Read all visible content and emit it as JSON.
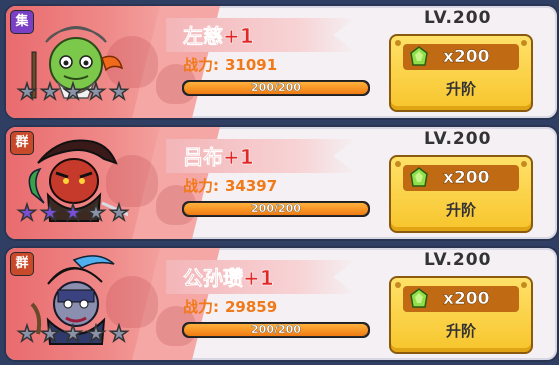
{
  "heroes": [
    {
      "faction": "集",
      "faction_color": "#7a3fc4",
      "name": "左慈+1",
      "power_label": "战力:",
      "power_value": "31091",
      "progress_text": "200/200",
      "progress": 1.0,
      "stars_filled": 0,
      "level": "LV.200",
      "cost": "x200",
      "upgrade_label": "升阶",
      "portrait": "zuo-ci-portrait"
    },
    {
      "faction": "群",
      "faction_color": "#c94a2a",
      "name": "吕布+1",
      "power_label": "战力:",
      "power_value": "34397",
      "progress_text": "200/200",
      "progress": 1.0,
      "stars_filled": 3,
      "level": "LV.200",
      "cost": "x200",
      "upgrade_label": "升阶",
      "portrait": "lu-bu-portrait"
    },
    {
      "faction": "群",
      "faction_color": "#c94a2a",
      "name": "公孙瓒+1",
      "power_label": "战力:",
      "power_value": "29859",
      "progress_text": "200/200",
      "progress": 1.0,
      "stars_filled": 0,
      "level": "LV.200",
      "cost": "x200",
      "upgrade_label": "升阶",
      "portrait": "gongsun-zan-portrait"
    }
  ],
  "colors": {
    "star_filled": "#7a4fd8",
    "star_empty": "#8a93a8",
    "name": "#e12828",
    "power": "#f07a1a"
  }
}
